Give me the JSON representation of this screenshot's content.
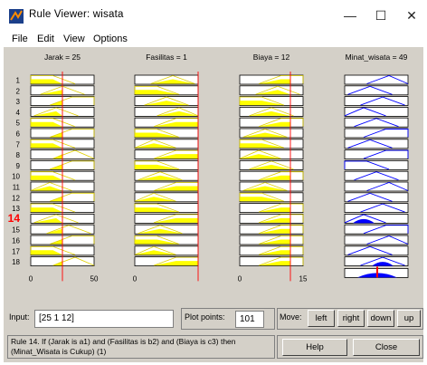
{
  "window": {
    "title": "Rule Viewer: wisata",
    "minimize": "—",
    "maximize": "☐",
    "close": "✕"
  },
  "menu": [
    "File",
    "Edit",
    "View",
    "Options"
  ],
  "columns": [
    {
      "header": "Jarak = 25",
      "axis": [
        "0",
        "50"
      ]
    },
    {
      "header": "Fasilitas = 1",
      "axis": [
        "0",
        ""
      ]
    },
    {
      "header": "Biaya = 12",
      "axis": [
        "0",
        "15"
      ]
    },
    {
      "header": "Minat_wisata = 49",
      "axis": [
        "",
        ""
      ]
    }
  ],
  "rule_numbers": [
    "1",
    "2",
    "3",
    "4",
    "5",
    "6",
    "7",
    "8",
    "9",
    "10",
    "11",
    "12",
    "13",
    "14",
    "15",
    "16",
    "17",
    "18"
  ],
  "selected_rule": "14",
  "input": {
    "label": "Input:",
    "value": "[25 1 12]"
  },
  "plot_points": {
    "label": "Plot points:",
    "value": "101"
  },
  "move": {
    "label": "Move:",
    "buttons": [
      "left",
      "right",
      "down",
      "up"
    ]
  },
  "status": "Rule 14. If (Jarak is a1) and (Fasilitas is b2) and (Biaya is c3) then (Minat_Wisata is Cukup) (1)",
  "help_label": "Help",
  "close_label": "Close",
  "colors": {
    "fill": "#ffff00",
    "output": "#0000ff",
    "marker": "#ff0000",
    "panel": "#d4d0c8"
  }
}
